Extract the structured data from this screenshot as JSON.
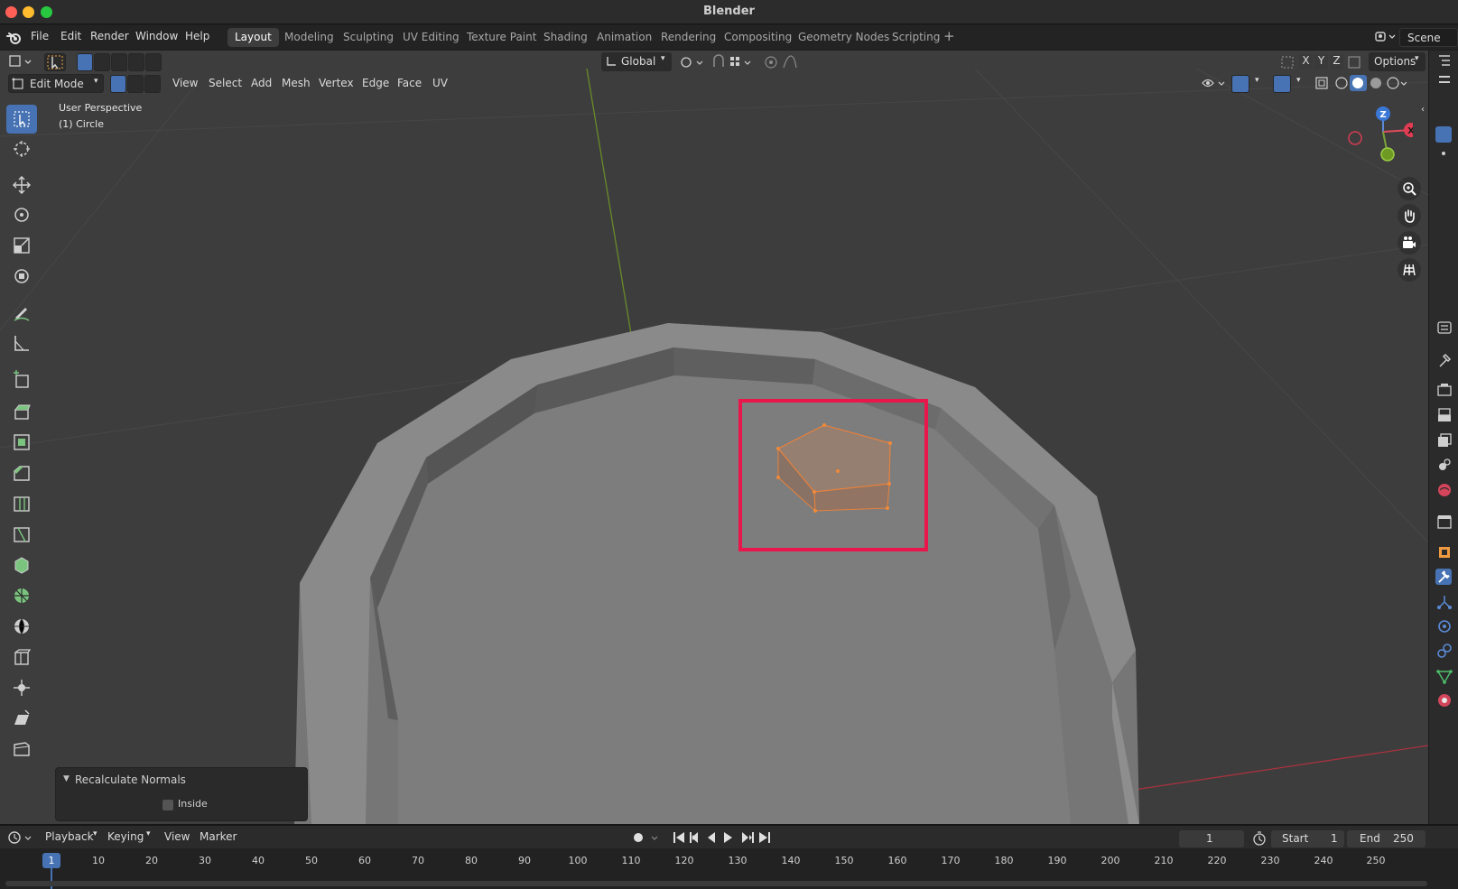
{
  "window": {
    "title": "Blender"
  },
  "menubar": {
    "items": [
      "File",
      "Edit",
      "Render",
      "Window",
      "Help"
    ],
    "workspaces": [
      "Layout",
      "Modeling",
      "Sculpting",
      "UV Editing",
      "Texture Paint",
      "Shading",
      "Animation",
      "Rendering",
      "Compositing",
      "Geometry Nodes",
      "Scripting"
    ],
    "active_workspace": "Layout",
    "scene": "Scene"
  },
  "viewport_header": {
    "pivot": "Global",
    "options": "Options",
    "axes": [
      "X",
      "Y",
      "Z"
    ],
    "mode": "Edit Mode",
    "menus": [
      "View",
      "Select",
      "Add",
      "Mesh",
      "Vertex",
      "Edge",
      "Face",
      "UV"
    ]
  },
  "viewport_overlay": {
    "perspective": "User Perspective",
    "object": "(1) Circle",
    "gizmo_axes": {
      "z": "Z",
      "x": "X"
    }
  },
  "operator_panel": {
    "title": "Recalculate Normals",
    "option": "Inside",
    "option_checked": false
  },
  "timeline": {
    "menus": [
      "Playback",
      "Keying",
      "View",
      "Marker"
    ],
    "current_frame": "1",
    "start_label": "Start",
    "start": "1",
    "end_label": "End",
    "end": "250",
    "ruler": [
      "1",
      "10",
      "20",
      "30",
      "40",
      "50",
      "60",
      "70",
      "80",
      "90",
      "100",
      "110",
      "120",
      "130",
      "140",
      "150",
      "160",
      "170",
      "180",
      "190",
      "200",
      "210",
      "220",
      "230",
      "240",
      "250"
    ]
  },
  "colors": {
    "accent": "#4772b3",
    "selection": "#e8813c",
    "highlight_box": "#e8164a"
  }
}
